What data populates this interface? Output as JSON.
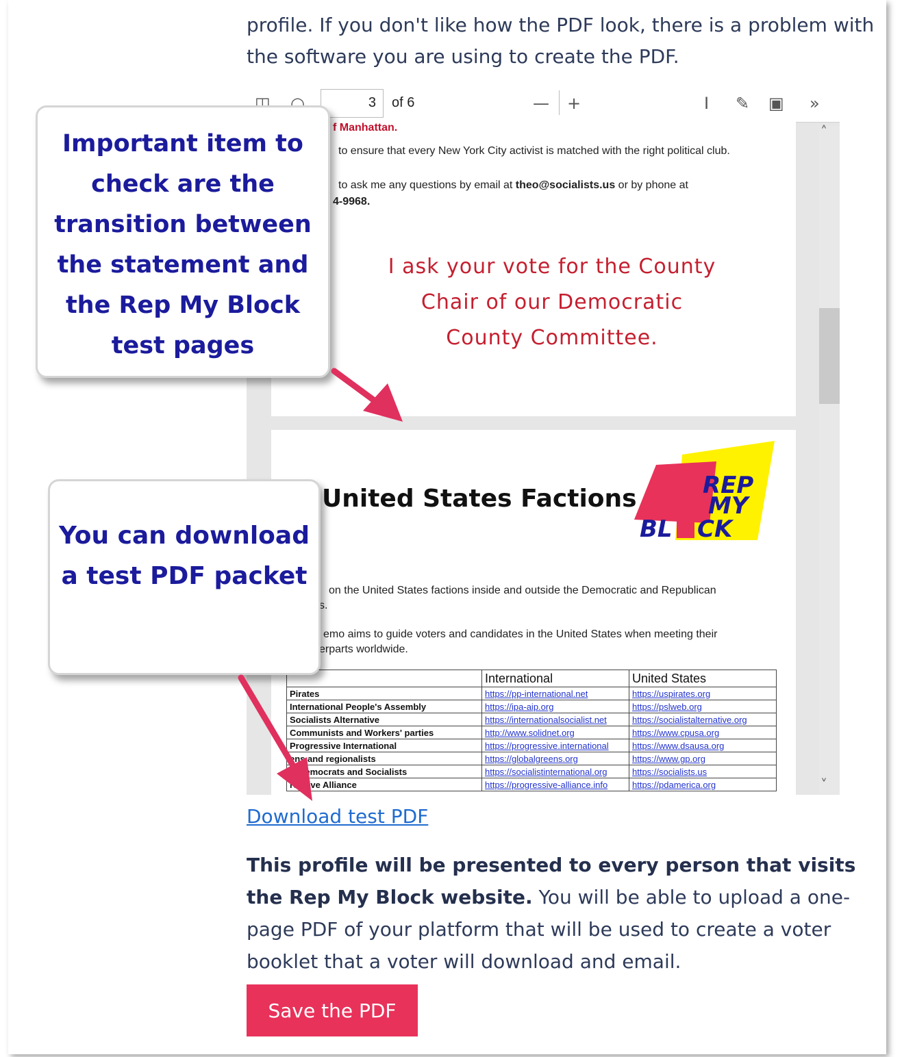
{
  "intro_text": "profile. If you don't like how the PDF look, there is a problem with the software you are using to create the PDF.",
  "viewer": {
    "page_current": "3",
    "page_total_label": "of 6",
    "toolbar_icons": [
      "sidebar-icon",
      "search-icon",
      "zoom-out-icon",
      "zoom-in-icon",
      "text-select-icon",
      "draw-icon",
      "image-icon",
      "more-icon"
    ],
    "page1": {
      "heading_fragment": "f Manhattan.",
      "line1": "to ensure that every New York City activist is matched with the right political club.",
      "line2_prefix": "to ask me any questions by email at ",
      "email": "theo@socialists.us",
      "line2_suffix": " or by phone at",
      "phone_fragment": "4-9968.",
      "vote_line1": "I ask your vote for the County",
      "vote_line2": "Chair of our Democratic",
      "vote_line3": "County Committee."
    },
    "page2": {
      "title": "United States Factions",
      "logo_text": [
        "REP",
        "MY",
        "BL",
        "CK"
      ],
      "para1": "on the United States factions inside and outside the Democratic and Republican",
      "para1b": "s.",
      "para2": "emo aims to guide voters and candidates in the United States when meeting their",
      "para2b": "erparts worldwide.",
      "table": {
        "headers": [
          "",
          "International",
          "United States"
        ],
        "rows": [
          [
            "Pirates",
            "https://pp-international.net",
            "https://uspirates.org"
          ],
          [
            "International People's Assembly",
            "https://ipa-aip.org",
            "https://pslweb.org"
          ],
          [
            "Socialists Alternative",
            "https://internationalsocialist.net",
            "https://socialistalternative.org"
          ],
          [
            "Communists and Workers' parties",
            "http://www.solidnet.org",
            "https://www.cpusa.org"
          ],
          [
            "Progressive International",
            "https://progressive.international",
            "https://www.dsausa.org"
          ],
          [
            "ens and regionalists",
            "https://globalgreens.org",
            "https://www.gp.org"
          ],
          [
            "al democrats and Socialists",
            "https://socialistinternational.org",
            "https://socialists.us"
          ],
          [
            "ressive Alliance",
            "https://progressive-alliance.info",
            "https://pdamerica.org"
          ]
        ]
      }
    }
  },
  "callouts": {
    "first": "Important item to check are the transition between the statement and the Rep My Block test pages",
    "second": "You can download a test PDF packet"
  },
  "download_link": "Download test PDF",
  "body": {
    "bold": "This profile will be presented to every person that visits the Rep My Block website.",
    "rest": " You will be able to upload a one-page PDF of your platform that will be used to create a voter booklet that a voter will download and email."
  },
  "save_button": "Save the PDF",
  "colors": {
    "accent": "#e8325a",
    "callout_text": "#1b1b9c",
    "arrow": "#e0305e",
    "link": "#1f6bcf"
  }
}
